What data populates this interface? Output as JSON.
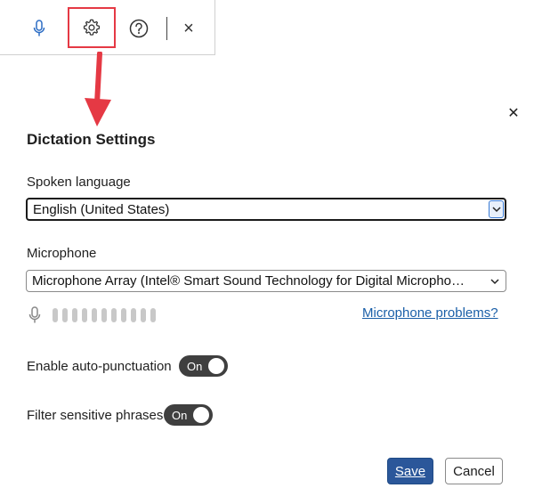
{
  "toolbar": {
    "mic_icon": "microphone-icon",
    "settings_icon": "gear-icon",
    "help_icon": "question-circle-icon",
    "close_icon": "close-icon",
    "close_glyph": "×"
  },
  "dialog": {
    "title": "Dictation Settings",
    "close_glyph": "✕",
    "spoken_language": {
      "label": "Spoken language",
      "value": "English (United States)"
    },
    "microphone": {
      "label": "Microphone",
      "value": "Microphone Array (Intel® Smart Sound Technology for Digital Micropho…",
      "level_fraction": 0,
      "problems_link": "Microphone problems?"
    },
    "auto_punctuation": {
      "label": "Enable auto-punctuation",
      "state": "On"
    },
    "filter_phrases": {
      "label": "Filter sensitive phrases",
      "state": "On"
    },
    "save_label": "Save",
    "cancel_label": "Cancel"
  },
  "colors": {
    "accent": "#2b579a",
    "highlight": "#e53944",
    "link": "#1a5fa8",
    "toggle_on": "#3f3f3f"
  }
}
